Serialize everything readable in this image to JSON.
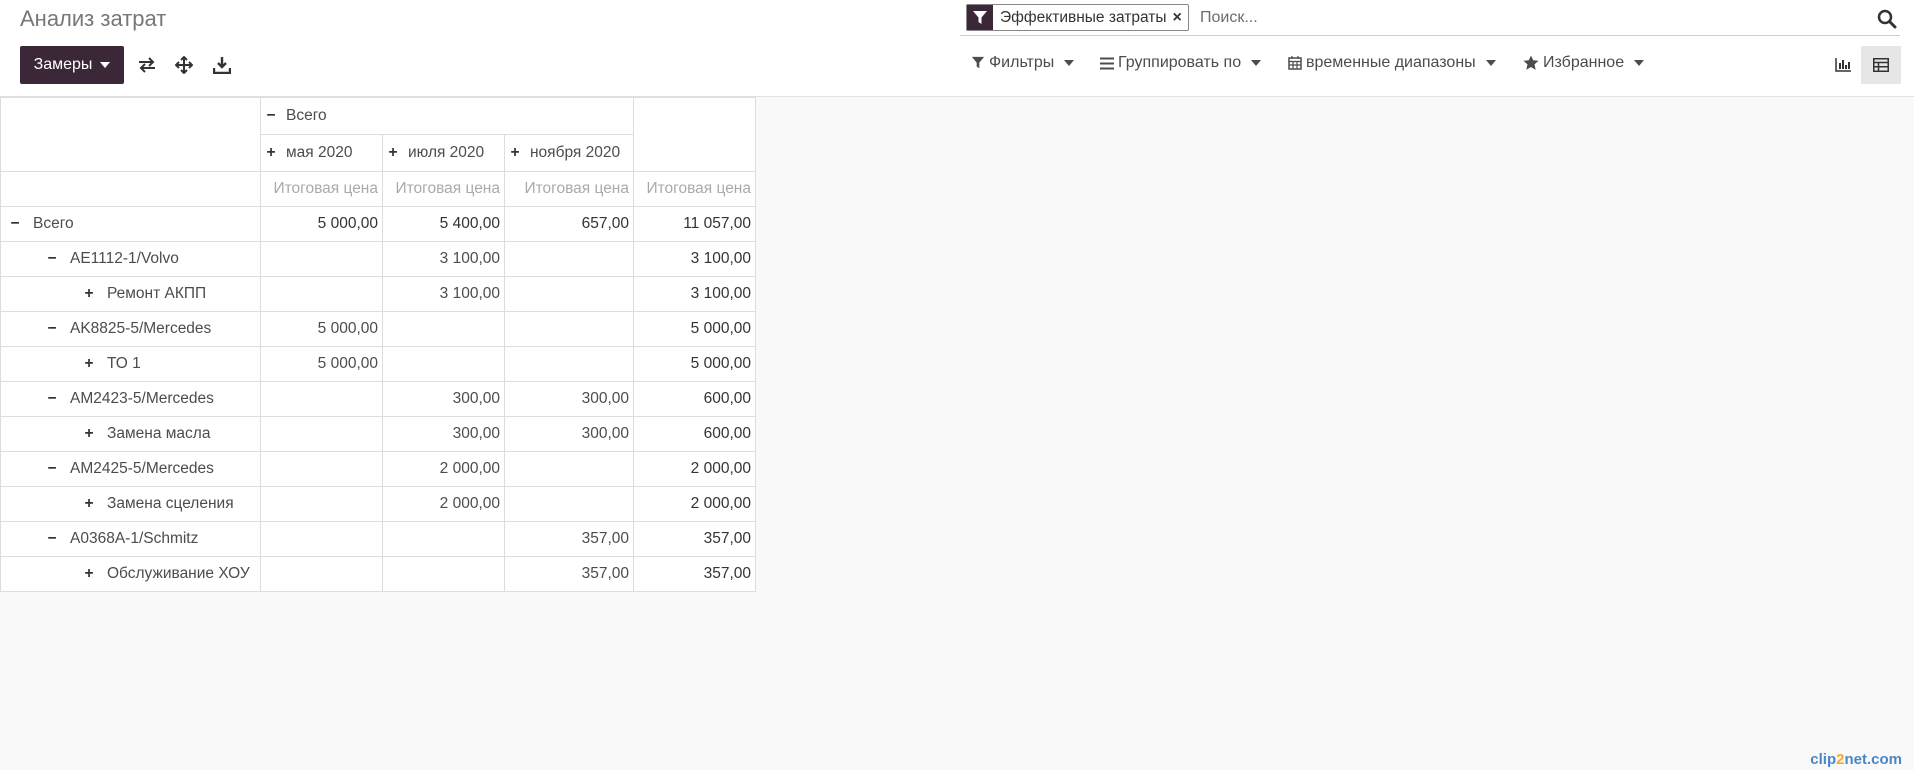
{
  "breadcrumb": "Анализ затрат",
  "toolbar": {
    "measures_label": "Замеры"
  },
  "search": {
    "facet_label": "Эффективные затраты",
    "facet_remove": "×",
    "placeholder": "Поиск..."
  },
  "filters": [
    {
      "label": "Фильтры",
      "icon": "filter-icon"
    },
    {
      "label": "Группировать по",
      "icon": "bars-icon"
    },
    {
      "label": "временные диапазоны",
      "icon": "calendar-icon"
    },
    {
      "label": "Избранное",
      "icon": "star-icon"
    }
  ],
  "views": [
    {
      "name": "graph",
      "icon": "bar-chart-icon"
    },
    {
      "name": "pivot",
      "icon": "table-icon",
      "active": true
    }
  ],
  "pivot": {
    "col_total_label": "Всего",
    "col_groups": [
      "мая 2020",
      "июля 2020",
      "ноября 2020"
    ],
    "measure_label": "Итоговая цена",
    "rows": [
      {
        "label": "Всего",
        "level": 0,
        "sign": "−",
        "values": [
          "5 000,00",
          "5 400,00",
          "657,00"
        ],
        "total": "11 057,00",
        "bold": true
      },
      {
        "label": "AE1112-1/Volvo",
        "level": 1,
        "sign": "−",
        "values": [
          "",
          "3 100,00",
          ""
        ],
        "total": "3 100,00"
      },
      {
        "label": "Ремонт АКПП",
        "level": 2,
        "sign": "+",
        "values": [
          "",
          "3 100,00",
          ""
        ],
        "total": "3 100,00"
      },
      {
        "label": "AK8825-5/Mercedes",
        "level": 1,
        "sign": "−",
        "values": [
          "5 000,00",
          "",
          ""
        ],
        "total": "5 000,00"
      },
      {
        "label": "ТО 1",
        "level": 2,
        "sign": "+",
        "values": [
          "5 000,00",
          "",
          ""
        ],
        "total": "5 000,00"
      },
      {
        "label": "AM2423-5/Mercedes",
        "level": 1,
        "sign": "−",
        "values": [
          "",
          "300,00",
          "300,00"
        ],
        "total": "600,00"
      },
      {
        "label": "Замена масла",
        "level": 2,
        "sign": "+",
        "values": [
          "",
          "300,00",
          "300,00"
        ],
        "total": "600,00"
      },
      {
        "label": "AM2425-5/Mercedes",
        "level": 1,
        "sign": "−",
        "values": [
          "",
          "2 000,00",
          ""
        ],
        "total": "2 000,00"
      },
      {
        "label": "Замена сцеления",
        "level": 2,
        "sign": "+",
        "values": [
          "",
          "2 000,00",
          ""
        ],
        "total": "2 000,00"
      },
      {
        "label": "A0368A-1/Schmitz",
        "level": 1,
        "sign": "−",
        "values": [
          "",
          "",
          "357,00"
        ],
        "total": "357,00"
      },
      {
        "label": "Обслуживание ХОУ",
        "level": 2,
        "sign": "+",
        "values": [
          "",
          "",
          "357,00"
        ],
        "total": "357,00"
      }
    ]
  },
  "watermark": {
    "pre": "clip",
    "mid": "2",
    "post": "net.com"
  },
  "colors": {
    "primary": "#3c2739",
    "border": "#dddddd",
    "measure_text": "#aaaaaa"
  }
}
